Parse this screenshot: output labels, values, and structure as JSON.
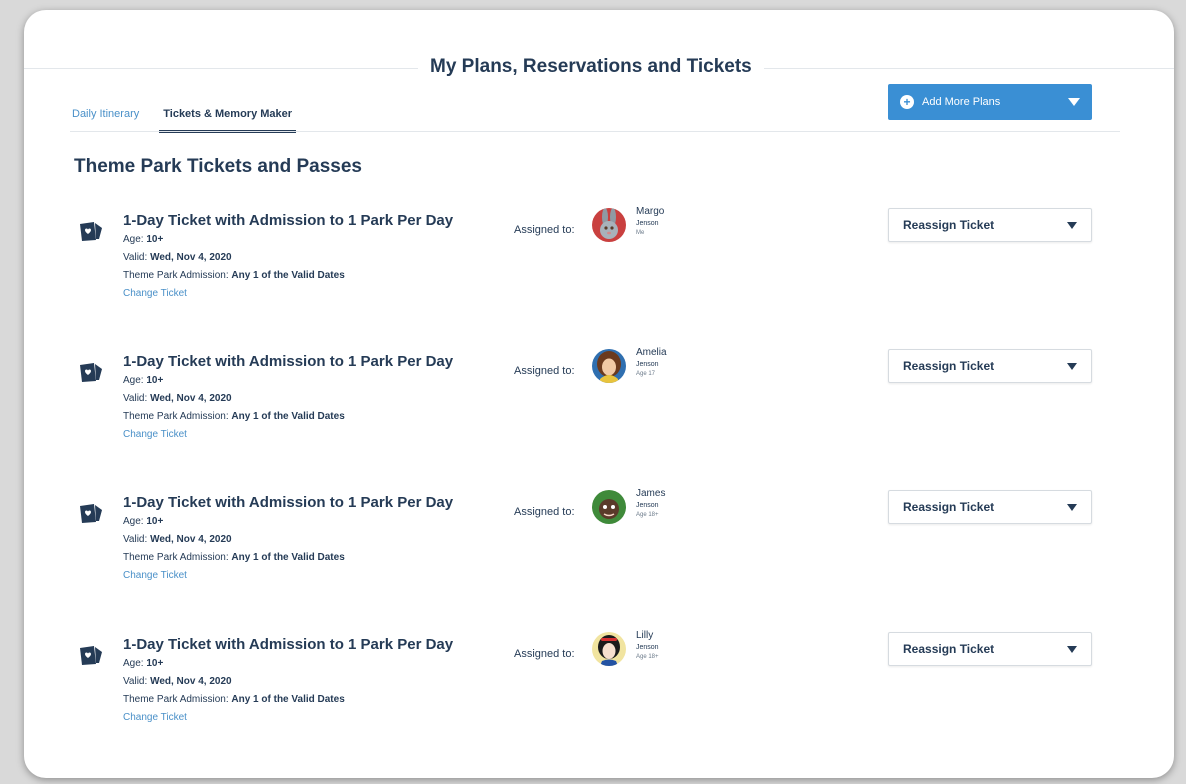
{
  "page_title": "My Plans, Reservations and Tickets",
  "tabs": [
    {
      "label": "Daily Itinerary",
      "active": false
    },
    {
      "label": "Tickets & Memory Maker",
      "active": true
    }
  ],
  "add_button": {
    "label": "Add More Plans",
    "icon": "plus-circle-icon",
    "color": "#3a8fd4"
  },
  "section_title": "Theme Park Tickets and Passes",
  "ticket_labels": {
    "age": "Age:",
    "valid": "Valid:",
    "admission": "Theme Park Admission:",
    "change": "Change Ticket",
    "assigned": "Assigned to:",
    "reassign": "Reassign Ticket"
  },
  "tickets": [
    {
      "name": "1-Day Ticket with Admission to 1 Park Per Day",
      "age": "10+",
      "valid": "Wed, Nov 4, 2020",
      "admission": "Any 1 of the Valid Dates",
      "guest": {
        "first": "Margo",
        "last": "Jenson",
        "age": "Me",
        "avatar": "rabbit-character-avatar"
      }
    },
    {
      "name": "1-Day Ticket with Admission to 1 Park Per Day",
      "age": "10+",
      "valid": "Wed, Nov 4, 2020",
      "admission": "Any 1 of the Valid Dates",
      "guest": {
        "first": "Amelia",
        "last": "Jenson",
        "age": "Age 17",
        "avatar": "princess-character-avatar"
      }
    },
    {
      "name": "1-Day Ticket with Admission to 1 Park Per Day",
      "age": "10+",
      "valid": "Wed, Nov 4, 2020",
      "admission": "Any 1 of the Valid Dates",
      "guest": {
        "first": "James",
        "last": "Jenson",
        "age": "Age 18+",
        "avatar": "green-character-avatar"
      }
    },
    {
      "name": "1-Day Ticket with Admission to 1 Park Per Day",
      "age": "10+",
      "valid": "Wed, Nov 4, 2020",
      "admission": "Any 1 of the Valid Dates",
      "guest": {
        "first": "Lilly",
        "last": "Jenson",
        "age": "Age 18+",
        "avatar": "snow-princess-character-avatar"
      }
    }
  ],
  "colors": {
    "heading": "#253b56",
    "link": "#4a90c8",
    "accent": "#3a8fd4"
  }
}
